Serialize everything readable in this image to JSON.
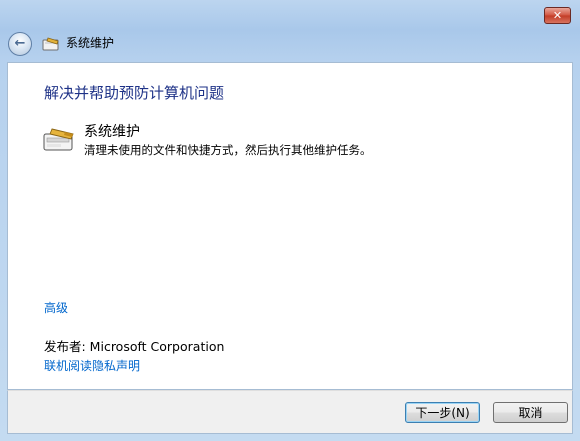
{
  "window": {
    "title": "系统维护",
    "close_glyph": "✕",
    "back_glyph": "←"
  },
  "main": {
    "heading": "解决并帮助预防计算机问题",
    "task": {
      "title": "系统维护",
      "description": "清理未使用的文件和快捷方式，然后执行其他维护任务。",
      "icon": "maintenance-icon"
    },
    "advanced_link": "高级",
    "publisher": "发布者:  Microsoft Corporation",
    "privacy_link": "联机阅读隐私声明"
  },
  "footer": {
    "next_label": "下一步(N)",
    "cancel_label": "取消"
  },
  "colors": {
    "heading": "#1e3287",
    "link": "#0066cc",
    "title_bar": "#a9c8ea"
  }
}
